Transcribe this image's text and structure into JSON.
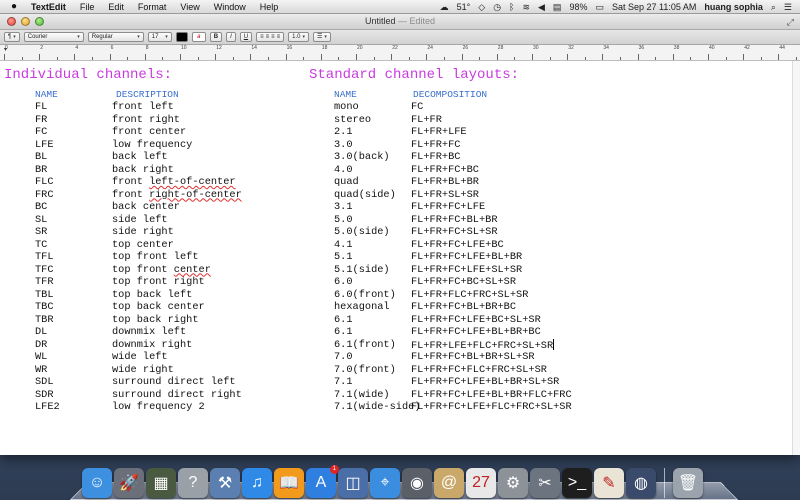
{
  "menubar": {
    "app_name": "TextEdit",
    "items": [
      "File",
      "Edit",
      "Format",
      "View",
      "Window",
      "Help"
    ],
    "temperature": "51°",
    "battery": "98%",
    "datetime": "Sat Sep 27  11:05 AM",
    "user": "huang sophia"
  },
  "window": {
    "title": "Untitled",
    "title_suffix": "— Edited"
  },
  "toolbar": {
    "font_family": "Courier",
    "font_style": "Regular",
    "font_size": "17",
    "bold": "B",
    "italic": "I",
    "underline": "U",
    "line_spacing": "1.0",
    "highlight_glyph": "a"
  },
  "ruler": {
    "numbers": [
      "0",
      "2",
      "4",
      "6",
      "8",
      "10",
      "12",
      "14",
      "16",
      "18",
      "20",
      "22",
      "24",
      "26",
      "28",
      "30",
      "32",
      "34",
      "36",
      "38",
      "40",
      "42",
      "44"
    ]
  },
  "document": {
    "heading_left": "Individual channels:",
    "heading_right": "Standard channel layouts:",
    "col_name": "NAME",
    "col_description": "DESCRIPTION",
    "col_layout_name": "NAME",
    "col_decomposition": "DECOMPOSITION",
    "channels": [
      {
        "name": "FL",
        "desc": "front left"
      },
      {
        "name": "FR",
        "desc": "front right"
      },
      {
        "name": "FC",
        "desc": "front center"
      },
      {
        "name": "LFE",
        "desc": "low frequency"
      },
      {
        "name": "BL",
        "desc": "back left"
      },
      {
        "name": "BR",
        "desc": "back right"
      },
      {
        "name": "FLC",
        "desc": "front left-of-center"
      },
      {
        "name": "FRC",
        "desc": "front right-of-center"
      },
      {
        "name": "BC",
        "desc": "back center"
      },
      {
        "name": "SL",
        "desc": "side left"
      },
      {
        "name": "SR",
        "desc": "side right"
      },
      {
        "name": "TC",
        "desc": "top center"
      },
      {
        "name": "TFL",
        "desc": "top front left"
      },
      {
        "name": "TFC",
        "desc": "top front center"
      },
      {
        "name": "TFR",
        "desc": "top front right"
      },
      {
        "name": "TBL",
        "desc": "top back left"
      },
      {
        "name": "TBC",
        "desc": "top back center"
      },
      {
        "name": "TBR",
        "desc": "top back right"
      },
      {
        "name": "DL",
        "desc": "downmix left"
      },
      {
        "name": "DR",
        "desc": "downmix right"
      },
      {
        "name": "WL",
        "desc": "wide left"
      },
      {
        "name": "WR",
        "desc": "wide right"
      },
      {
        "name": "SDL",
        "desc": "surround direct left"
      },
      {
        "name": "SDR",
        "desc": "surround direct right"
      },
      {
        "name": "LFE2",
        "desc": "low frequency 2"
      }
    ],
    "layouts": [
      {
        "name": "mono",
        "dec": "FC"
      },
      {
        "name": "stereo",
        "dec": "FL+FR"
      },
      {
        "name": "2.1",
        "dec": "FL+FR+LFE"
      },
      {
        "name": "3.0",
        "dec": "FL+FR+FC"
      },
      {
        "name": "3.0(back)",
        "dec": "FL+FR+BC"
      },
      {
        "name": "4.0",
        "dec": "FL+FR+FC+BC"
      },
      {
        "name": "quad",
        "dec": "FL+FR+BL+BR"
      },
      {
        "name": "quad(side)",
        "dec": "FL+FR+SL+SR"
      },
      {
        "name": "3.1",
        "dec": "FL+FR+FC+LFE"
      },
      {
        "name": "5.0",
        "dec": "FL+FR+FC+BL+BR"
      },
      {
        "name": "5.0(side)",
        "dec": "FL+FR+FC+SL+SR"
      },
      {
        "name": "4.1",
        "dec": "FL+FR+FC+LFE+BC"
      },
      {
        "name": "5.1",
        "dec": "FL+FR+FC+LFE+BL+BR"
      },
      {
        "name": "5.1(side)",
        "dec": "FL+FR+FC+LFE+SL+SR"
      },
      {
        "name": "6.0",
        "dec": "FL+FR+FC+BC+SL+SR"
      },
      {
        "name": "6.0(front)",
        "dec": "FL+FR+FLC+FRC+SL+SR"
      },
      {
        "name": "hexagonal",
        "dec": "FL+FR+FC+BL+BR+BC"
      },
      {
        "name": "6.1",
        "dec": "FL+FR+FC+LFE+BC+SL+SR"
      },
      {
        "name": "6.1",
        "dec": "FL+FR+FC+LFE+BL+BR+BC"
      },
      {
        "name": "6.1(front)",
        "dec": "FL+FR+LFE+FLC+FRC+SL+SR"
      },
      {
        "name": "7.0",
        "dec": "FL+FR+FC+BL+BR+SL+SR"
      },
      {
        "name": "7.0(front)",
        "dec": "FL+FR+FC+FLC+FRC+SL+SR"
      },
      {
        "name": "7.1",
        "dec": "FL+FR+FC+LFE+BL+BR+SL+SR"
      },
      {
        "name": "7.1(wide)",
        "dec": "FL+FR+FC+LFE+BL+BR+FLC+FRC"
      },
      {
        "name": "7.1(wide-side)",
        "dec": "FL+FR+FC+LFE+FLC+FRC+SL+SR"
      }
    ],
    "misspelled": [
      "left-of-center",
      "right-of-center",
      "center"
    ]
  },
  "dock": {
    "items": [
      {
        "name": "finder-icon",
        "glyph": "☺",
        "color": "#3d8fe0"
      },
      {
        "name": "launchpad-icon",
        "glyph": "🚀",
        "color": "#6a6f7a"
      },
      {
        "name": "mission-control-icon",
        "glyph": "▦",
        "color": "#4a5a40"
      },
      {
        "name": "help-icon",
        "glyph": "?",
        "color": "#9aa0a8"
      },
      {
        "name": "xcode-icon",
        "glyph": "⚒",
        "color": "#5a7fb0"
      },
      {
        "name": "itunes-icon",
        "glyph": "♫",
        "color": "#2e8ae6"
      },
      {
        "name": "ibooks-icon",
        "glyph": "📖",
        "color": "#f29a1c"
      },
      {
        "name": "app-store-icon",
        "glyph": "A",
        "color": "#2f7fe0",
        "badge": "1"
      },
      {
        "name": "preview-icon",
        "glyph": "◫",
        "color": "#4a6fa8"
      },
      {
        "name": "safari-icon",
        "glyph": "⌖",
        "color": "#3b8de0"
      },
      {
        "name": "screenshot-icon",
        "glyph": "◉",
        "color": "#5a5f68"
      },
      {
        "name": "contacts-icon",
        "glyph": "@",
        "color": "#c9a86a"
      },
      {
        "name": "calendar-icon",
        "glyph": "27",
        "color": "#e8e8e8"
      },
      {
        "name": "system-preferences-icon",
        "glyph": "⚙",
        "color": "#8d9299"
      },
      {
        "name": "utilities-icon",
        "glyph": "✂",
        "color": "#6c7480"
      },
      {
        "name": "terminal-icon",
        "glyph": ">_",
        "color": "#1e1e1e"
      },
      {
        "name": "textedit-icon",
        "glyph": "✎",
        "color": "#e9e4d6"
      },
      {
        "name": "photo-booth-icon",
        "glyph": "◍",
        "color": "#3a4a6a"
      },
      {
        "name": "trash-icon",
        "glyph": "🗑",
        "color": "#9ba3ad"
      }
    ]
  }
}
